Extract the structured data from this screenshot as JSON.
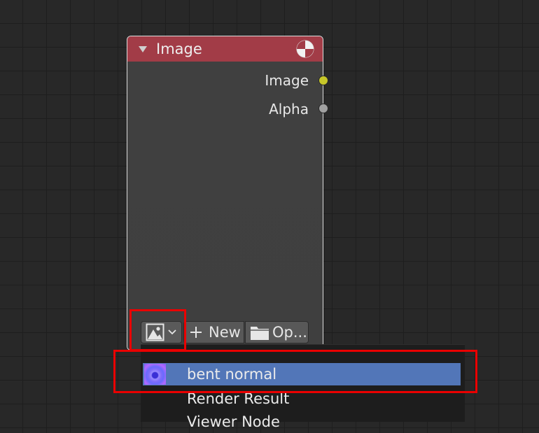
{
  "node": {
    "title": "Image",
    "header_color": "#a23c47",
    "outputs": [
      {
        "label": "Image",
        "socket_color": "#c7c729"
      },
      {
        "label": "Alpha",
        "socket_color": "#a1a1a1"
      }
    ],
    "buttons": {
      "new_label": "New",
      "open_label": "Op..."
    }
  },
  "dropdown": {
    "items": [
      {
        "label": "bent normal",
        "selected": true,
        "thumbnail": "bent-normal-thumbnail"
      },
      {
        "label": "Render Result",
        "selected": false
      },
      {
        "label": "Viewer Node",
        "selected": false
      }
    ],
    "highlight_color": "#5276b8"
  },
  "annotations": {
    "color": "#ea0000"
  },
  "icons": {
    "collapse": "triangle-down-icon",
    "preview": "preview-sphere-icon",
    "browse": "image-icon",
    "new": "plus-icon",
    "open": "folder-icon"
  }
}
